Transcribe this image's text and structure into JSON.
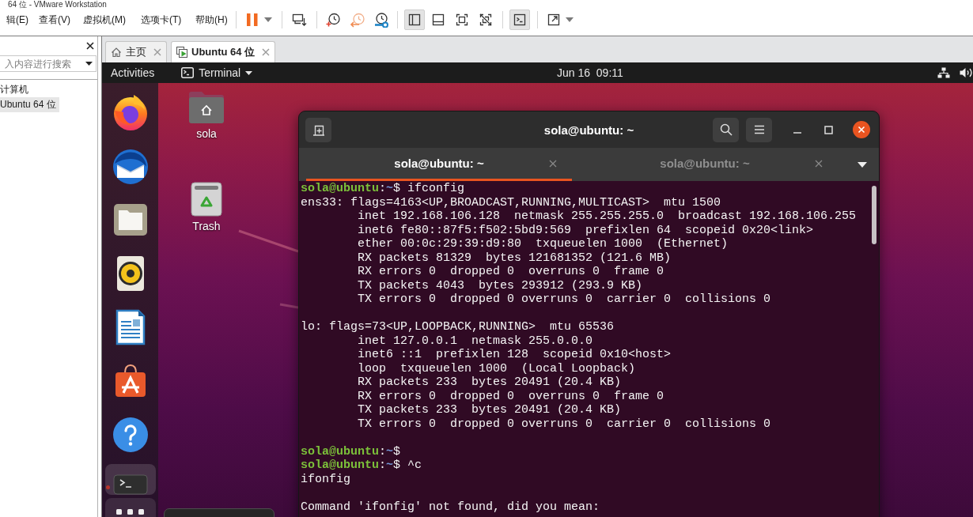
{
  "window": {
    "title": "64 位 - VMware Workstation"
  },
  "menu_bar": [
    "辑(E)",
    "查看(V)",
    "虚拟机(M)",
    "选项卡(T)",
    "帮助(H)"
  ],
  "toolbar": {
    "toggles": [
      {
        "on": true
      },
      {
        "on": false
      },
      {
        "on": false
      },
      {
        "on": false
      },
      {
        "on": true
      }
    ]
  },
  "sidebar": {
    "search": {
      "placeholder": "入内容进行搜索"
    },
    "tree": [
      {
        "label": "计算机",
        "selected": false
      },
      {
        "label": "Ubuntu 64 位",
        "selected": true
      }
    ]
  },
  "tabs": [
    {
      "label": "主页",
      "selected": false
    },
    {
      "label": "Ubuntu 64 位",
      "selected": true
    }
  ],
  "guest": {
    "top_bar": {
      "activities": "Activities",
      "app_menu": "Terminal",
      "clock": "Jun 16  09:11"
    },
    "dock": [
      {
        "running": false,
        "selected": false
      },
      {
        "running": false,
        "selected": false
      },
      {
        "running": false,
        "selected": false
      },
      {
        "running": false,
        "selected": false
      },
      {
        "running": false,
        "selected": false
      },
      {
        "running": false,
        "selected": false
      },
      {
        "running": false,
        "selected": false
      },
      {
        "running": true,
        "selected": true
      }
    ],
    "desktop_icons": [
      {
        "label": "sola"
      },
      {
        "label": "Trash"
      }
    ],
    "terminal": {
      "title": "sola@ubuntu: ~",
      "tabs": [
        {
          "label": "sola@ubuntu: ~",
          "selected": true
        },
        {
          "label": "sola@ubuntu: ~",
          "selected": false
        }
      ],
      "lines": [
        {
          "kind": "prompt",
          "user": "sola@ubuntu",
          "sep": ":",
          "path": "~",
          "symbol": "$",
          "command": "ifconfig"
        },
        {
          "kind": "output",
          "text": "ens33: flags=4163<UP,BROADCAST,RUNNING,MULTICAST>  mtu 1500"
        },
        {
          "kind": "indented",
          "text": "inet 192.168.106.128  netmask 255.255.255.0  broadcast 192.168.106.255"
        },
        {
          "kind": "indented",
          "text": "inet6 fe80::87f5:f502:5bd9:569  prefixlen 64  scopeid 0x20<link>"
        },
        {
          "kind": "indented",
          "text": "ether 00:0c:29:39:d9:80  txqueuelen 1000  (Ethernet)"
        },
        {
          "kind": "indented",
          "text": "RX packets 81329  bytes 121681352 (121.6 MB)"
        },
        {
          "kind": "indented",
          "text": "RX errors 0  dropped 0  overruns 0  frame 0"
        },
        {
          "kind": "indented",
          "text": "TX packets 4043  bytes 293912 (293.9 KB)"
        },
        {
          "kind": "indented",
          "text": "TX errors 0  dropped 0 overruns 0  carrier 0  collisions 0"
        },
        {
          "kind": "blank"
        },
        {
          "kind": "output",
          "text": "lo: flags=73<UP,LOOPBACK,RUNNING>  mtu 65536"
        },
        {
          "kind": "indented",
          "text": "inet 127.0.0.1  netmask 255.0.0.0"
        },
        {
          "kind": "indented",
          "text": "inet6 ::1  prefixlen 128  scopeid 0x10<host>"
        },
        {
          "kind": "indented",
          "text": "loop  txqueuelen 1000  (Local Loopback)"
        },
        {
          "kind": "indented",
          "text": "RX packets 233  bytes 20491 (20.4 KB)"
        },
        {
          "kind": "indented",
          "text": "RX errors 0  dropped 0  overruns 0  frame 0"
        },
        {
          "kind": "indented",
          "text": "TX packets 233  bytes 20491 (20.4 KB)"
        },
        {
          "kind": "indented",
          "text": "TX errors 0  dropped 0 overruns 0  carrier 0  collisions 0"
        },
        {
          "kind": "blank"
        },
        {
          "kind": "prompt",
          "user": "sola@ubuntu",
          "sep": ":",
          "path": "~",
          "symbol": "$"
        },
        {
          "kind": "prompt",
          "user": "sola@ubuntu",
          "sep": ":",
          "path": "~",
          "symbol": "$",
          "command": "^c"
        },
        {
          "kind": "output",
          "text": "ifonfig"
        },
        {
          "kind": "blank"
        },
        {
          "kind": "output",
          "text": "Command 'ifonfig' not found, did you mean:"
        }
      ]
    }
  }
}
